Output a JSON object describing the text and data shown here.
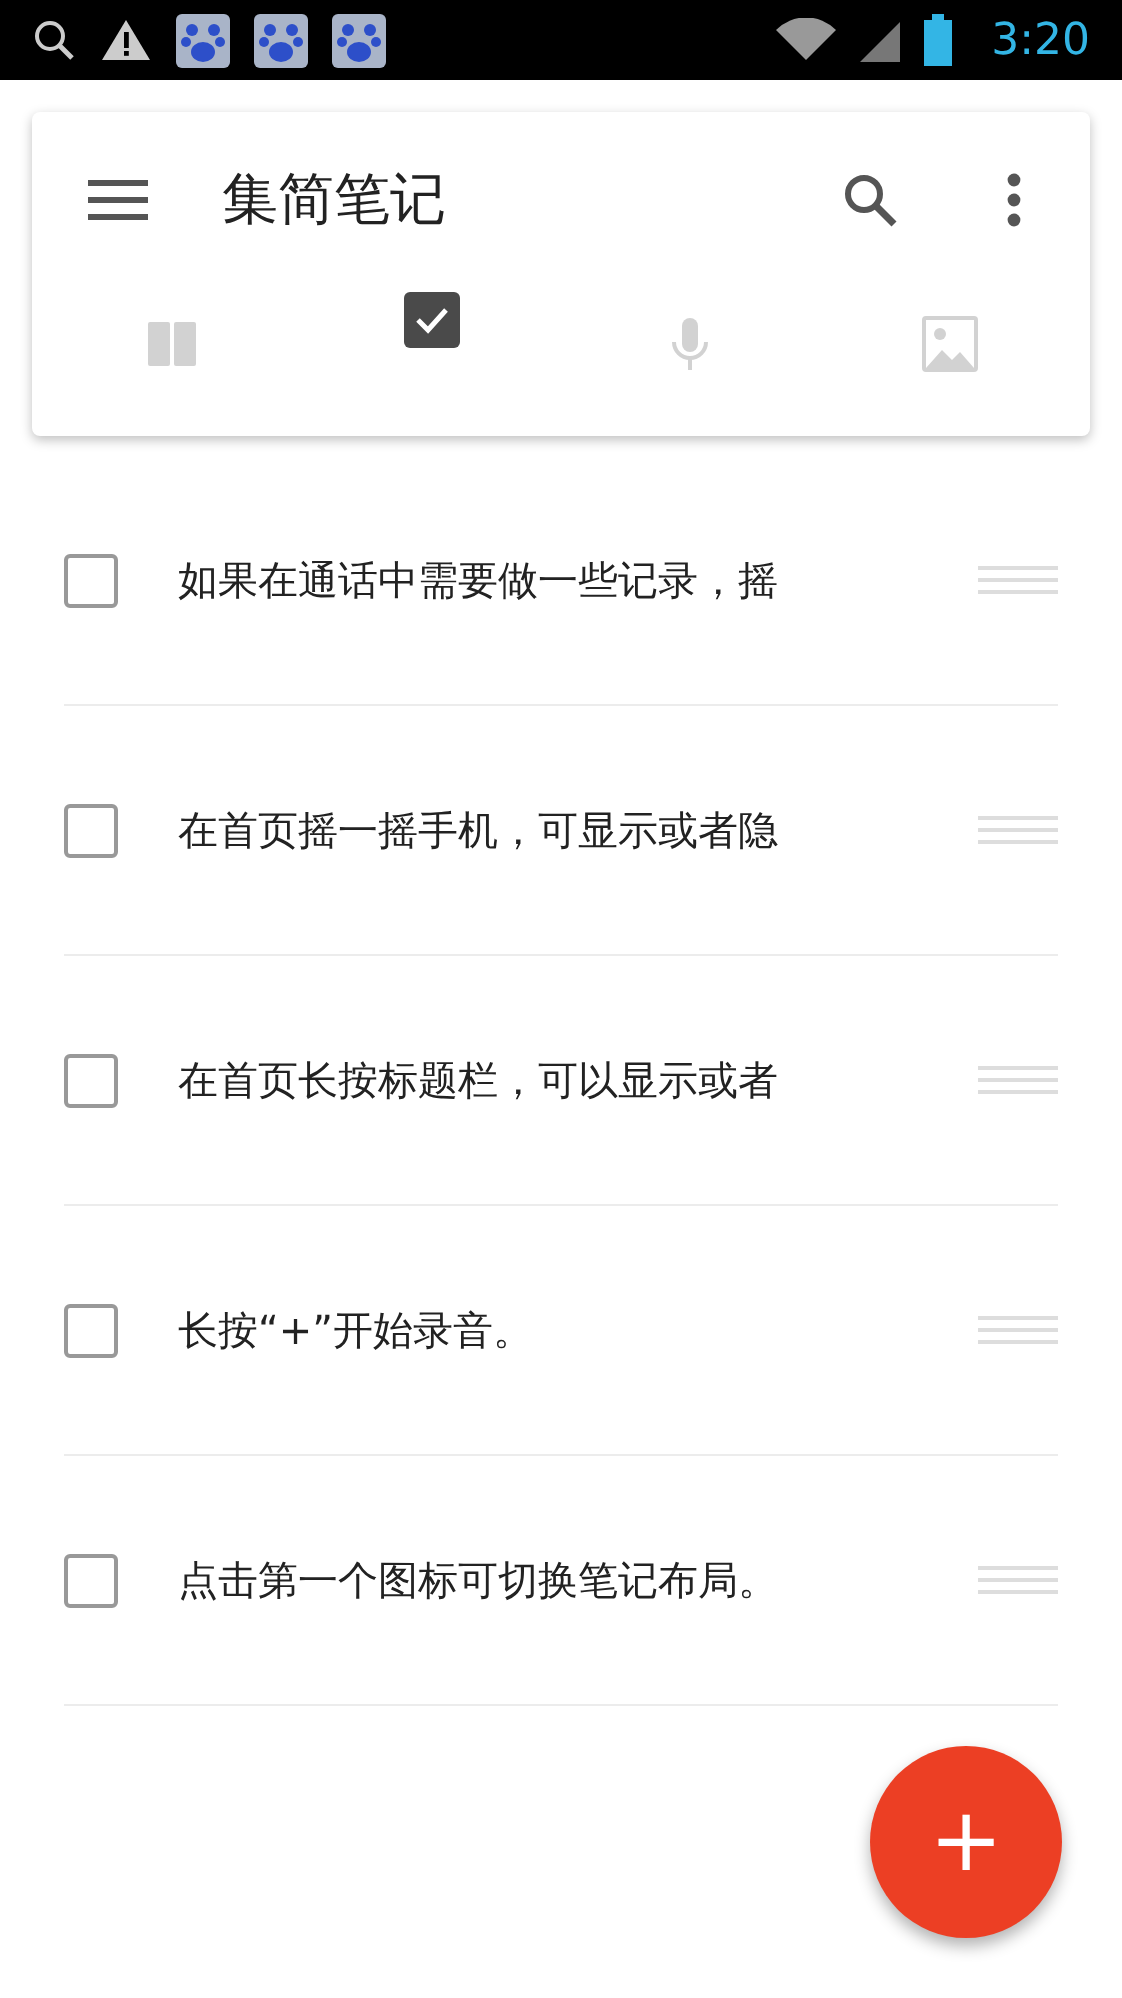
{
  "status_bar": {
    "time": "3:20"
  },
  "app_bar": {
    "title": "集简笔记"
  },
  "tabs": [
    {
      "kind": "layout",
      "selected": false
    },
    {
      "kind": "checklist",
      "selected": true
    },
    {
      "kind": "voice",
      "selected": false
    },
    {
      "kind": "image",
      "selected": false
    }
  ],
  "notes": [
    {
      "text": "如果在通话中需要做一些记录，摇",
      "checked": false
    },
    {
      "text": "在首页摇一摇手机，可显示或者隐",
      "checked": false
    },
    {
      "text": "在首页长按标题栏，可以显示或者",
      "checked": false
    },
    {
      "text": "长按“+”开始录音。",
      "checked": false
    },
    {
      "text": "点击第一个图标可切换笔记布局。",
      "checked": false
    }
  ],
  "fab": {
    "label": "+"
  }
}
